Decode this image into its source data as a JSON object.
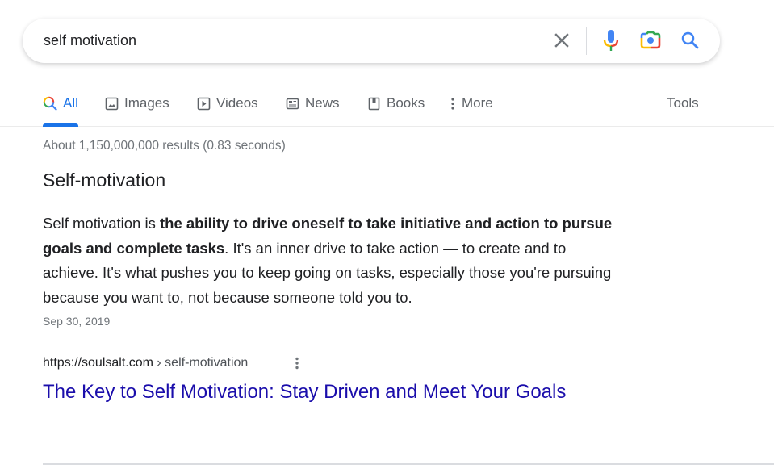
{
  "search": {
    "query": "self motivation",
    "clear_icon": "close-icon",
    "voice_icon": "microphone-icon",
    "lens_icon": "camera-lens-icon",
    "search_icon": "search-icon"
  },
  "tabs": [
    {
      "label": "All",
      "icon": "search-icon",
      "active": true
    },
    {
      "label": "Images",
      "icon": "image-icon",
      "active": false
    },
    {
      "label": "Videos",
      "icon": "play-icon",
      "active": false
    },
    {
      "label": "News",
      "icon": "newspaper-icon",
      "active": false
    },
    {
      "label": "Books",
      "icon": "book-icon",
      "active": false
    },
    {
      "label": "More",
      "icon": "more-vertical-icon",
      "active": false
    }
  ],
  "tools_label": "Tools",
  "result_stats": "About 1,150,000,000 results (0.83 seconds)",
  "featured_snippet": {
    "title": "Self-motivation",
    "text_before": "Self motivation is ",
    "text_bold": "the ability to drive oneself to take initiative and action to pursue goals and complete tasks",
    "text_after": ". It's an inner drive to take action — to create and to achieve. It's what pushes you to keep going on tasks, especially those you're pursuing because you want to, not because someone told you to.",
    "date": "Sep 30, 2019"
  },
  "result": {
    "url_domain": "https://soulsalt.com",
    "url_path": " › self-motivation",
    "title": "The Key to Self Motivation: Stay Driven and Meet Your Goals"
  },
  "colors": {
    "accent": "#1a73e8",
    "link": "#1a0dab",
    "muted": "#70757a"
  }
}
